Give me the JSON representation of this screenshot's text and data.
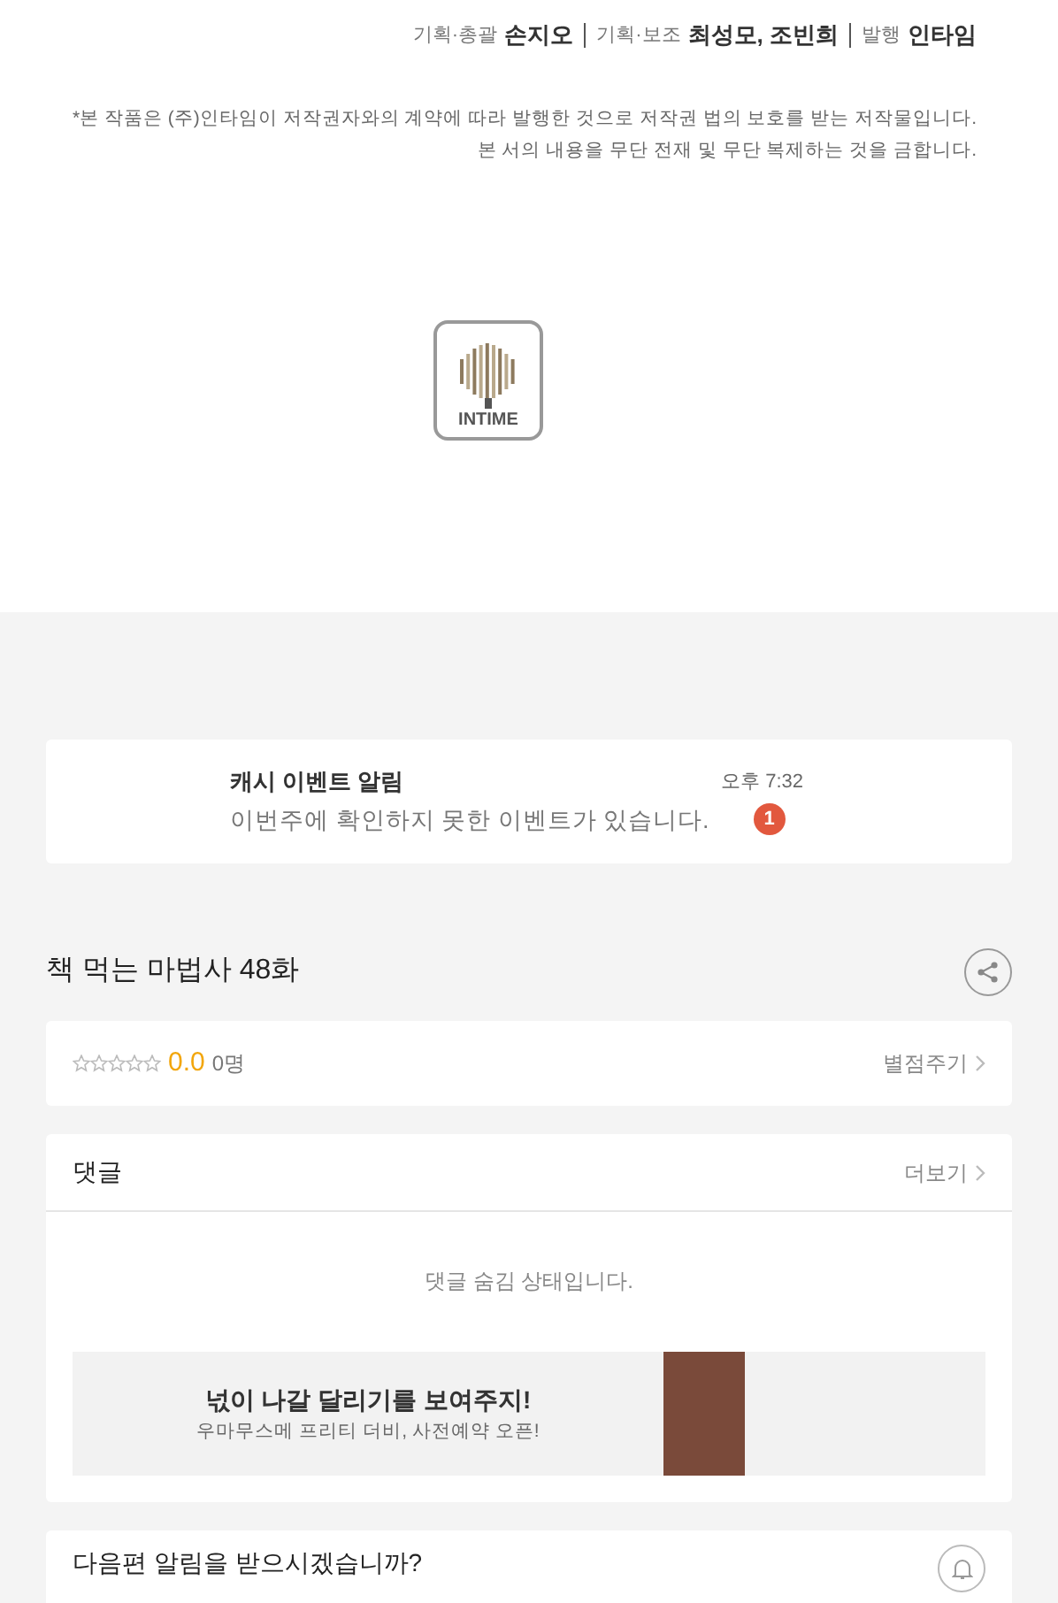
{
  "credits": [
    {
      "label": "기획·총괄",
      "name": "손지오"
    },
    {
      "label": "기획·보조",
      "name": "최성모, 조빈희"
    },
    {
      "label": "발행",
      "name": "인타임"
    }
  ],
  "notice": [
    "*본 작품은 (주)인타임이 저작권자와의 계약에 따라 발행한 것으로 저작권 법의 보호를 받는 저작물입니다.",
    "본 서의 내용을 무단 전재 및 무단 복제하는 것을 금합니다."
  ],
  "logo": {
    "text": "INTIME"
  },
  "notification": {
    "title": "캐시 이벤트 알림",
    "message": "이번주에 확인하지 못한 이벤트가 있습니다.",
    "time": "오후 7:32",
    "badge": "1"
  },
  "episode": {
    "title": "책 먹는 마법사 48화"
  },
  "rating": {
    "stars": 0,
    "score": "0.0",
    "count": "0명",
    "action": "별점주기"
  },
  "comments": {
    "title": "댓글",
    "more": "더보기",
    "message": "댓글 숨김 상태입니다."
  },
  "ad": {
    "headline": "넋이 나갈 달리기를 보여주지!",
    "subline": "우마무스메 프리티 더비, 사전예약 오픈!"
  },
  "next": {
    "question": "다음편 알림을 받으시겠습니까?"
  }
}
